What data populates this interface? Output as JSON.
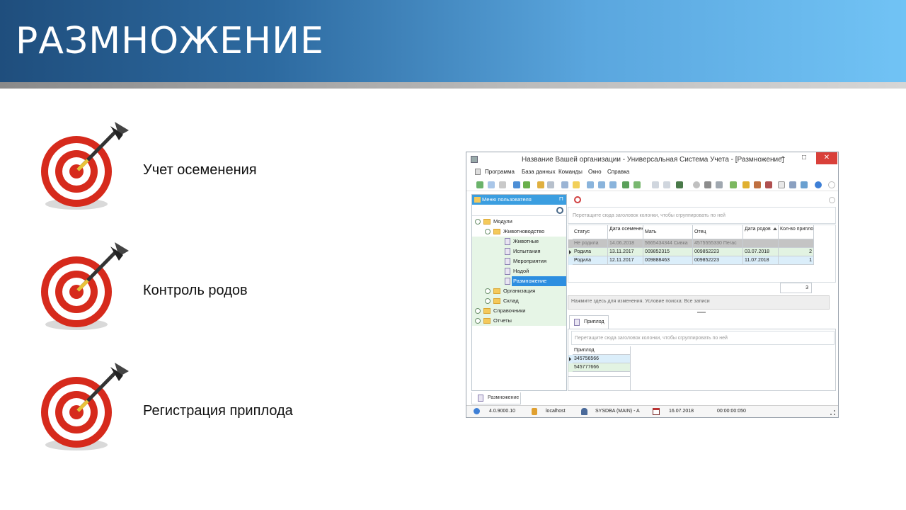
{
  "slide": {
    "title": "РАЗМНОЖЕНИЕ",
    "bullets": [
      "Учет осеменения",
      "Контроль родов",
      "Регистрация приплода"
    ]
  },
  "window": {
    "title": "Название Вашей организации - Универсальная Система Учета - [Размножение]",
    "controls": {
      "minimize": "–",
      "maximize": "□",
      "close": "✕"
    },
    "menu": [
      "Программа",
      "База данных",
      "Команды",
      "Окно",
      "Справка"
    ],
    "sidebar": {
      "header": "Меню пользователя",
      "pin": "⊓",
      "tree": [
        {
          "label": "Модули",
          "level": 0,
          "type": "folder"
        },
        {
          "label": "Животноводство",
          "level": 1,
          "type": "folder"
        },
        {
          "label": "Животные",
          "level": 2,
          "type": "doc"
        },
        {
          "label": "Испытания",
          "level": 2,
          "type": "doc"
        },
        {
          "label": "Мероприятия",
          "level": 2,
          "type": "doc"
        },
        {
          "label": "Надой",
          "level": 2,
          "type": "doc"
        },
        {
          "label": "Размножение",
          "level": 2,
          "type": "doc",
          "selected": true
        },
        {
          "label": "Организация",
          "level": 1,
          "type": "folder"
        },
        {
          "label": "Склад",
          "level": 1,
          "type": "folder"
        },
        {
          "label": "Справочники",
          "level": 0,
          "type": "folder"
        },
        {
          "label": "Отчеты",
          "level": 0,
          "type": "folder"
        }
      ]
    },
    "group_hint": "Перетащите сюда заголовок колонки, чтобы сгруппировать по ней",
    "grid": {
      "columns": [
        "Статус",
        "Дата осеменения",
        "Мать",
        "Отец",
        "Дата родов",
        "Кол-во приплода"
      ],
      "rows": [
        [
          "Не родила",
          "14.06.2018",
          "5665434344 Сивка",
          "4575555330 Пегас",
          "",
          ""
        ],
        [
          "Родила",
          "13.11.2017",
          "009852315",
          "009852223",
          "03.07.2018",
          "2"
        ],
        [
          "Родила",
          "12.11.2017",
          "009888463",
          "009852223",
          "11.07.2018",
          "1"
        ]
      ],
      "footer_count": "3"
    },
    "filter_text": "Нажмите здесь для изменения. Условие поиска: Все записи",
    "detail_tab": "Приплод",
    "detail_grid": {
      "column": "Приплод",
      "rows": [
        "345756566",
        "545777666"
      ]
    },
    "bottom_tab": "Размножение",
    "status": {
      "version": "4.0.9000.10",
      "host": "localhost",
      "user": "SYSDBA (MAIN) - A",
      "date": "16.07.2018",
      "time": "00:00:00:050"
    }
  }
}
